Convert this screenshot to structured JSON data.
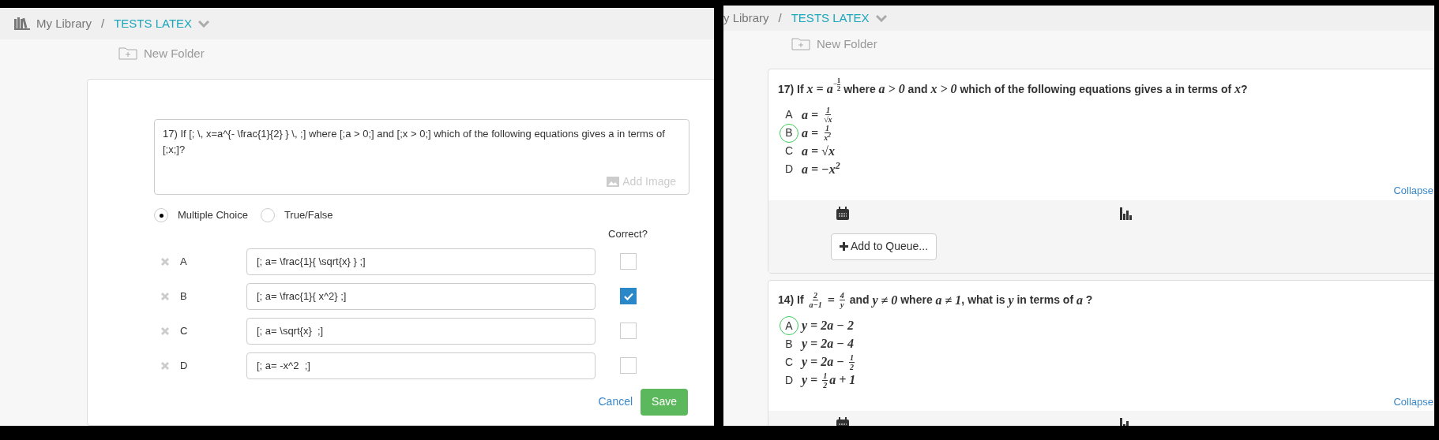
{
  "editor": {
    "breadcrumb": {
      "root": "My Library",
      "separator": "/",
      "current": "TESTS LATEX"
    },
    "new_folder": "New Folder",
    "question_text": "17) If [; \\, x=a^{- \\frac{1}{2} } \\, ;] where [;a > 0;] and [;x > 0;] which of the following equations gives a in terms of [;x;]?",
    "add_image": "Add Image",
    "types": [
      {
        "label": "Multiple Choice",
        "selected": true
      },
      {
        "label": "True/False",
        "selected": false
      }
    ],
    "correct_header": "Correct?",
    "options": [
      {
        "letter": "A",
        "value": "[; a= \\frac{1}{ \\sqrt{x} } ;]",
        "checked": false
      },
      {
        "letter": "B",
        "value": "[; a= \\frac{1}{ x^2} ;]",
        "checked": true
      },
      {
        "letter": "C",
        "value": "[; a= \\sqrt{x}  ;]",
        "checked": false
      },
      {
        "letter": "D",
        "value": "[; a= -x^2  ;]",
        "checked": false
      }
    ],
    "cancel": "Cancel",
    "save": "Save"
  },
  "preview": {
    "breadcrumb": {
      "root": "y Library",
      "separator": "/",
      "current": "TESTS LATEX"
    },
    "new_folder": "New Folder",
    "questions": [
      {
        "segments": [
          {
            "kind": "text",
            "text": "17) If "
          },
          {
            "kind": "math",
            "text": "x = a"
          },
          {
            "kind": "supfrac",
            "sign": "−",
            "num": "1",
            "den": "2"
          },
          {
            "kind": "text",
            "text": " where "
          },
          {
            "kind": "math",
            "text": "a > 0"
          },
          {
            "kind": "text",
            "text": " and "
          },
          {
            "kind": "math",
            "text": "x > 0"
          },
          {
            "kind": "text",
            "text": " which of the following equations gives a in terms of "
          },
          {
            "kind": "math",
            "text": "x"
          },
          {
            "kind": "text",
            "text": "?"
          }
        ],
        "options": [
          {
            "letter": "A",
            "selected": false,
            "segments": [
              {
                "kind": "math",
                "text": "a = "
              },
              {
                "kind": "frac",
                "num": "1",
                "den": "√x"
              }
            ]
          },
          {
            "letter": "B",
            "selected": true,
            "segments": [
              {
                "kind": "math",
                "text": "a = "
              },
              {
                "kind": "frac",
                "num": "1",
                "den": "x$^{2}$"
              }
            ]
          },
          {
            "letter": "C",
            "selected": false,
            "segments": [
              {
                "kind": "math",
                "text": "a = √x"
              }
            ]
          },
          {
            "letter": "D",
            "selected": false,
            "segments": [
              {
                "kind": "math",
                "text": "a = −x$^{2}$"
              }
            ]
          }
        ],
        "collapse": "Collapse",
        "queue_button": "Add to Queue..."
      },
      {
        "segments": [
          {
            "kind": "text",
            "text": "14) If "
          },
          {
            "kind": "frac",
            "num": "2",
            "den": "a−1"
          },
          {
            "kind": "math",
            "text": " = "
          },
          {
            "kind": "frac",
            "num": "4",
            "den": "y"
          },
          {
            "kind": "text",
            "text": " and "
          },
          {
            "kind": "math",
            "text": "y ≠ 0"
          },
          {
            "kind": "text",
            "text": " where "
          },
          {
            "kind": "math",
            "text": "a ≠ 1"
          },
          {
            "kind": "text",
            "text": ", what is "
          },
          {
            "kind": "math",
            "text": "y"
          },
          {
            "kind": "text",
            "text": " in terms of "
          },
          {
            "kind": "math",
            "text": "a"
          },
          {
            "kind": "text",
            "text": " ?"
          }
        ],
        "options": [
          {
            "letter": "A",
            "selected": true,
            "segments": [
              {
                "kind": "math",
                "text": "y = 2a − 2"
              }
            ]
          },
          {
            "letter": "B",
            "selected": false,
            "segments": [
              {
                "kind": "math",
                "text": "y = 2a − 4"
              }
            ]
          },
          {
            "letter": "C",
            "selected": false,
            "segments": [
              {
                "kind": "math",
                "text": "y = 2a − "
              },
              {
                "kind": "frac",
                "num": "1",
                "den": "2"
              }
            ]
          },
          {
            "letter": "D",
            "selected": false,
            "segments": [
              {
                "kind": "math",
                "text": "y = "
              },
              {
                "kind": "frac",
                "num": "1",
                "den": "2"
              },
              {
                "kind": "math",
                "text": "a + 1"
              }
            ]
          }
        ],
        "collapse": "Collapse"
      }
    ]
  }
}
